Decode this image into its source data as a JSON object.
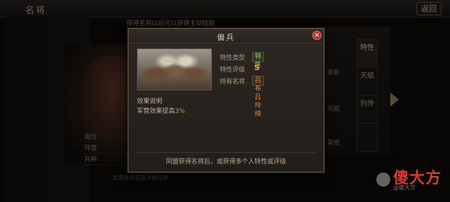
{
  "screen": {
    "title": "名将",
    "back_label": "返回",
    "subheader": "获得名将以后可以获得主动技能"
  },
  "background": {
    "row_labels": [
      "属性",
      "阵营",
      "兵种"
    ],
    "bottom_text": "点击名将查看详细信息",
    "right_labels": [
      "技能",
      "天赋",
      "其他"
    ],
    "side_tabs": [
      "特性",
      "天赋",
      "列传"
    ]
  },
  "modal": {
    "title": "偏兵",
    "close_glyph": "×",
    "attributes": [
      {
        "label": "特性类型",
        "value": "特性"
      },
      {
        "label": "特性评级",
        "value": "S"
      },
      {
        "label": "持有名将",
        "value": "吕布 吕玲绮"
      }
    ],
    "effect_title": "效果说明",
    "effect_text": "军营效果提高",
    "effect_value": "3%",
    "footer": "同盟获得名将后，或获得多个人特性或评级"
  },
  "watermark": {
    "text": "傻大方",
    "sub": "@傻大方"
  },
  "colors": {
    "accent_gold": "#a48a5c",
    "close_red": "#b8332a",
    "positive_green": "#7fc35a",
    "grade_orange": "#e8a53a"
  }
}
